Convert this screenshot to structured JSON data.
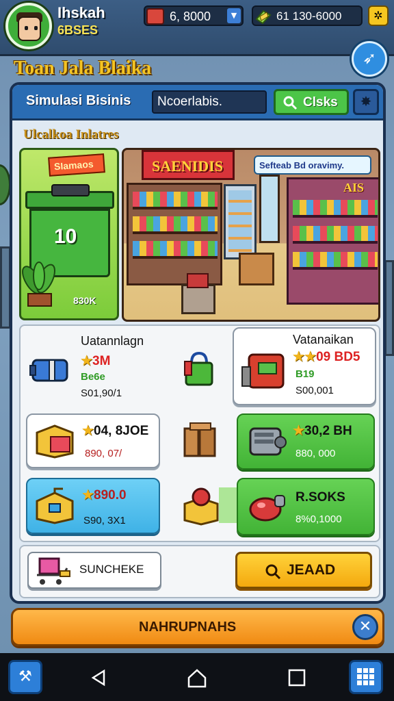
{
  "player": {
    "name": "Ihskah",
    "id_tag": "6BSES"
  },
  "resources": {
    "coins": "6, 8000",
    "gems": "61  130-6000"
  },
  "game_title": "Toan Jala Blaika",
  "panel": {
    "title": "Simulasi Bisinis",
    "search_value": "Ncoerlabis.",
    "green_button_label": "Clsks",
    "section_label": "Ulcalkoa Inlatres"
  },
  "scene": {
    "bin_sign": "SIamaos",
    "bin_number": "10",
    "bin_percent": "830K",
    "shop_sign": "SAENIDIS",
    "speech": "Sefteab Bd oravimy.",
    "shop_sign_right": "AIS"
  },
  "items": [
    {
      "title": "Uatannlagn",
      "rating": "3M",
      "sub": "Be6e",
      "price": "S01,90/1"
    },
    {
      "title": "Vatanaikan",
      "rating": "09  BD5",
      "sub": "B19",
      "price": "S00,001"
    },
    {
      "rating": "04, 8JOE",
      "price": "890, 07/"
    },
    {
      "rating": "30,2  BH",
      "price": "880, 000"
    },
    {
      "rating": "890.0",
      "price": "S90, 3X1"
    },
    {
      "rating": "R.SOKS",
      "price": "8%0,1000"
    }
  ],
  "actions": {
    "left_button": "SUNCHEKE",
    "right_button": "JEAAD"
  },
  "bottom_bar": "NAHRUPNAHS",
  "colors": {
    "panel_header": "#2a6cb3",
    "accent_yellow": "#f4c423",
    "green": "#4cc548",
    "orange": "#f08a12"
  }
}
